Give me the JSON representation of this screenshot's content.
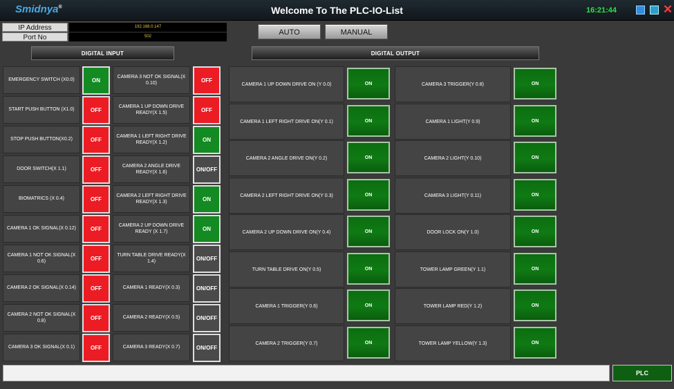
{
  "app": {
    "logo": "Smidnya",
    "logo_mark": "®",
    "title": "Welcome To The PLC-IO-List",
    "time": "16:21:44",
    "close_glyph": "✕"
  },
  "connection": {
    "ip_label": "IP Address",
    "ip_value": "192.168.0.147",
    "port_label": "Port No",
    "port_value": "502"
  },
  "modes": {
    "auto_label": "AUTO",
    "manual_label": "MANUAL"
  },
  "sections": {
    "input_title": "DIGITAL INPUT",
    "output_title": "DIGITAL OUTPUT"
  },
  "digital_inputs": {
    "col1": [
      {
        "label": "EMERGENCY SWITCH (X0.0)",
        "status": "ON"
      },
      {
        "label": "START PUSH BUTTON (X1.0)",
        "status": "OFF"
      },
      {
        "label": "STOP PUSH BUTTON(X0.2)",
        "status": "OFF"
      },
      {
        "label": "DOOR SWITCH(X 1.1)",
        "status": "OFF"
      },
      {
        "label": "BIOMATRICS (X 0.4)",
        "status": "OFF"
      },
      {
        "label": "CAMERA 1 OK SIGNAL(X 0.12)",
        "status": "OFF"
      },
      {
        "label": "CAMERA 1 NOT OK SIGNAL(X 0.6)",
        "status": "OFF"
      },
      {
        "label": "CAMERA 2 OK SIGNAL(X 0.14)",
        "status": "OFF"
      },
      {
        "label": "CAMERA 2 NOT OK SIGNAL(X 0.8)",
        "status": "OFF"
      },
      {
        "label": "CAMERA 3 OK SIGNAL(X 0.1)",
        "status": "OFF"
      }
    ],
    "col2": [
      {
        "label": "CAMERA 3 NOT OK SIGNAL(X 0.10)",
        "status": "OFF"
      },
      {
        "label": "CAMERA 1 UP DOWN DRIVE READY(X 1.5)",
        "status": "OFF"
      },
      {
        "label": "CAMERA 1 LEFT RIGHT DRIVE READY(X 1.2)",
        "status": "ON"
      },
      {
        "label": "CAMERA 2 ANGLE DRIVE READY(X 1.6)",
        "status": "ON/OFF"
      },
      {
        "label": "CAMERA 2  LEFT RIGHT DRIVE  READY(X 1.3)",
        "status": "ON"
      },
      {
        "label": "CAMERA 2 UP DOWN DRIVE READY (X 1.7)",
        "status": "ON"
      },
      {
        "label": "TURN TABLE DRIVE READY(X 1.4)",
        "status": "ON/OFF"
      },
      {
        "label": "CAMERA 1 READY(X 0.3)",
        "status": "ON/OFF"
      },
      {
        "label": "CAMERA 2 READY(X 0.5)",
        "status": "ON/OFF"
      },
      {
        "label": "CAMERA 3 READY(X 0.7)",
        "status": "ON/OFF"
      }
    ]
  },
  "digital_outputs": {
    "col1": [
      {
        "label": "CAMERA 1 UP DOWN DRIVE ON (Y 0.0)",
        "status": "ON"
      },
      {
        "label": "CAMERA 1 LEFT RIGHT DRIVE ON(Y 0.1)",
        "status": "ON"
      },
      {
        "label": "CAMERA 2 ANGLE DRIVE ON(Y 0.2)",
        "status": "ON"
      },
      {
        "label": "CAMERA 2 LEFT RIGHT DRIVE ON(Y 0.3)",
        "status": "ON"
      },
      {
        "label": "CAMERA 2 UP DOWN DRIVE ON(Y 0.4)",
        "status": "ON"
      },
      {
        "label": "TURN TABLE DRIVE ON(Y 0.5)",
        "status": "ON"
      },
      {
        "label": "CAMERA 1 TRIGGER(Y 0.6)",
        "status": "ON"
      },
      {
        "label": "CAMERA 2 TRIGGER(Y 0.7)",
        "status": "ON"
      }
    ],
    "col2": [
      {
        "label": "CAMERA 3 TRIGGER(Y 0.8)",
        "status": "ON"
      },
      {
        "label": "CAMERA 1  LIGHT(Y 0.9)",
        "status": "ON"
      },
      {
        "label": "CAMERA 2 LIGHT(Y 0.10)",
        "status": "ON"
      },
      {
        "label": "CAMERA 3 LIGHT(Y 0.11)",
        "status": "ON"
      },
      {
        "label": "DOOR LOCK ON(Y 1.0)",
        "status": "ON"
      },
      {
        "label": "TOWER LAMP GREEN(Y 1.1)",
        "status": "ON"
      },
      {
        "label": "TOWER LAMP RED(Y 1.2)",
        "status": "ON"
      },
      {
        "label": "TOWER LAMP YELLOW(Y 1.3)",
        "status": "ON"
      }
    ]
  },
  "footer": {
    "message": "",
    "plc_label": "PLC"
  },
  "colors": {
    "on": "#138a22",
    "off": "#ec1c24",
    "onoff": "#4a4a4a",
    "clock": "#2fe04a",
    "logo": "#4aa8e8"
  }
}
